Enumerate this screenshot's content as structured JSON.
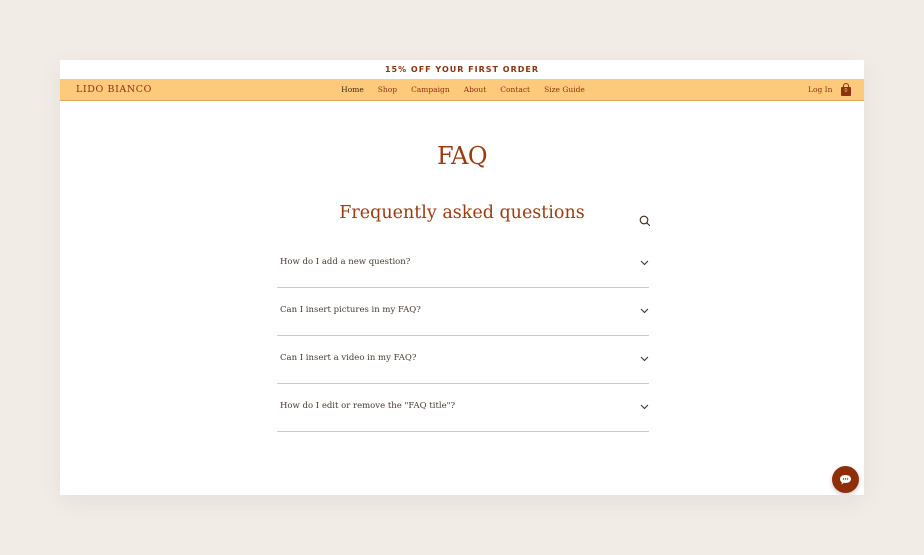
{
  "promo": {
    "text": "15% OFF YOUR FIRST ORDER"
  },
  "header": {
    "brand": "LIDO BIANCO",
    "nav": [
      "Home",
      "Shop",
      "Campaign",
      "About",
      "Contact",
      "Size Guide"
    ],
    "active_nav": "Home",
    "login_label": "Log In",
    "cart_count": "0"
  },
  "main": {
    "page_title": "FAQ",
    "section_title": "Frequently asked questions",
    "questions": [
      "How do I add a new question?",
      "Can I insert pictures in my FAQ?",
      "Can I insert a video in my FAQ?",
      "How do I edit or remove the \"FAQ title\"?"
    ]
  },
  "colors": {
    "accent": "#9a3b10",
    "nav_bg": "#fdc97a",
    "page_bg": "#f1ece6",
    "chat_button": "#8f2f0a"
  },
  "icons": {
    "search": "search-icon",
    "chevron": "chevron-down-icon",
    "cart": "shopping-bag-icon",
    "chat": "chat-bubble-icon"
  }
}
